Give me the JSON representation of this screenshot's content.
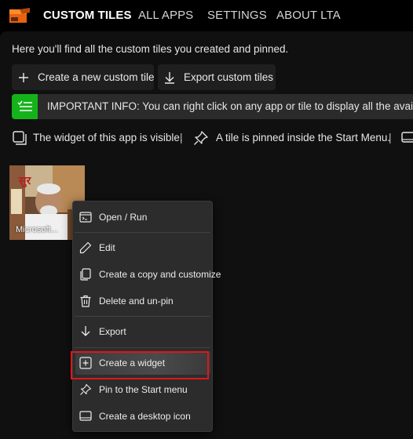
{
  "nav": {
    "tabs": [
      {
        "label": "CUSTOM TILES",
        "active": true
      },
      {
        "label": "ALL APPS",
        "active": false
      },
      {
        "label": "SETTINGS",
        "active": false
      },
      {
        "label": "ABOUT LTA",
        "active": false
      }
    ]
  },
  "page": {
    "intro": "Here you'll find all the custom tiles you created and pinned.",
    "actions": {
      "create_label": "Create a new custom tile",
      "export_label": "Export custom tiles"
    },
    "info_bar": {
      "text": "IMPORTANT INFO: You can right click on any app or tile to display all the available o",
      "accent_color": "#15b31a"
    },
    "legend": {
      "widget_text": "The widget of this app is visible.",
      "separator": "|",
      "pinned_text": "A tile is pinned inside the Start Menu."
    }
  },
  "tile": {
    "label": "Microsoft...",
    "image_text": "सुर"
  },
  "context_menu": {
    "items": [
      {
        "label": "Open / Run",
        "icon": "run-icon"
      },
      {
        "label": "Edit",
        "icon": "pencil-icon"
      },
      {
        "label": "Create a copy and customize",
        "icon": "copy-icon"
      },
      {
        "label": "Delete and un-pin",
        "icon": "trash-icon"
      },
      {
        "label": "Export",
        "icon": "download-arrow-icon"
      },
      {
        "label": "Create a widget",
        "icon": "add-widget-icon",
        "highlighted": true
      },
      {
        "label": "Pin to the Start menu",
        "icon": "pin-icon"
      },
      {
        "label": "Create a desktop icon",
        "icon": "desktop-icon"
      }
    ],
    "highlight_color": "#e0161b"
  }
}
